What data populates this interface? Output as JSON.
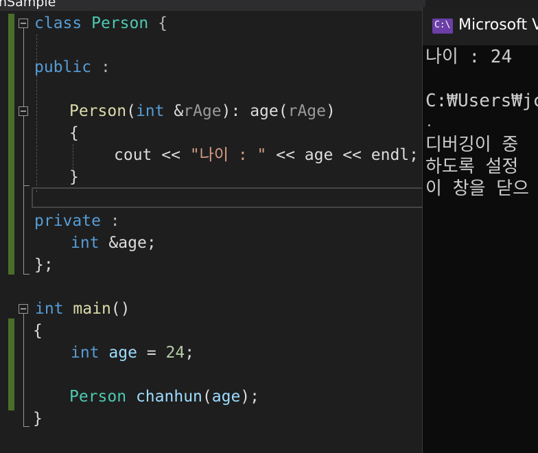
{
  "window_title": "nSample",
  "code_lines": [
    "class Person {",
    "public :",
    "Person(int &rAge): age(rAge)",
    "{",
    "cout << \"나이 : \" << age << endl;",
    "}",
    "private :",
    "int &age;",
    "};",
    "int main()",
    "{",
    "int age = 24;",
    "Person chanhun(age);",
    "}"
  ],
  "tokens": {
    "class": "class",
    "Person": "Person",
    "lbrace": "{",
    "rbrace": "}",
    "public": "public",
    "private": "private",
    "colon": ":",
    "int": "int",
    "amp": "&",
    "rAge": "rAge",
    "age": "age",
    "lparen": "(",
    "rparen": ")",
    "semi": ";",
    "close_class": "};",
    "cout": "cout",
    "shl": "<<",
    "string": "\"나이 : \"",
    "endl": "endl",
    "main": "main",
    "main_parens": "()",
    "eq": "=",
    "num": "24",
    "chanhun": "chanhun",
    "colon_sep": ":"
  },
  "console": {
    "title": "Microsoft V",
    "icon_text": "C:\\",
    "lines": [
      "나이 : 24",
      "",
      "C:₩Users₩jc",
      ".",
      "디버깅이 중",
      "하도록 설정",
      "이 창을 닫으"
    ]
  },
  "colors": {
    "keyword": "#569cd6",
    "type": "#4ec9b0",
    "function": "#dcdcaa",
    "parameter": "#9a9a9a",
    "string": "#d69d85",
    "number": "#b5cea8",
    "variable": "#9cdcfe",
    "text": "#dcdcdc",
    "change_bar": "#4a6e2a",
    "editor_bg": "#1e1e1e",
    "console_bg": "#0c0c0c"
  }
}
